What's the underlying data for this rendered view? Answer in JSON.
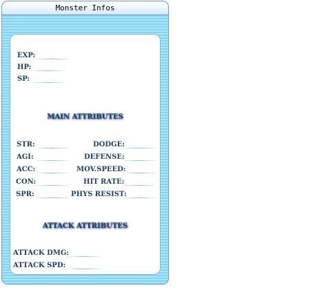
{
  "window": {
    "title": "Monster Infos"
  },
  "basic": {
    "exp": "EXP:",
    "hp": "HP:",
    "sp": "SP:"
  },
  "main_attributes": {
    "heading": "MAIN ATTRIBUTES",
    "str": "STR:",
    "agi": "AGI:",
    "acc": "ACC:",
    "con": "CON:",
    "spr": "SPR:",
    "dodge": "DODGE:",
    "defense": "DEFENSE:",
    "mov_speed": "MOV.SPEED:",
    "hit_rate": "HIT RATE:",
    "phys_resist": "PHYS RESIST:"
  },
  "attack_attributes": {
    "heading": "ATTACK ATTRIBUTES",
    "attack_dmg": "ATTACK DMG:",
    "attack_spd": "ATTACK SPD:"
  }
}
